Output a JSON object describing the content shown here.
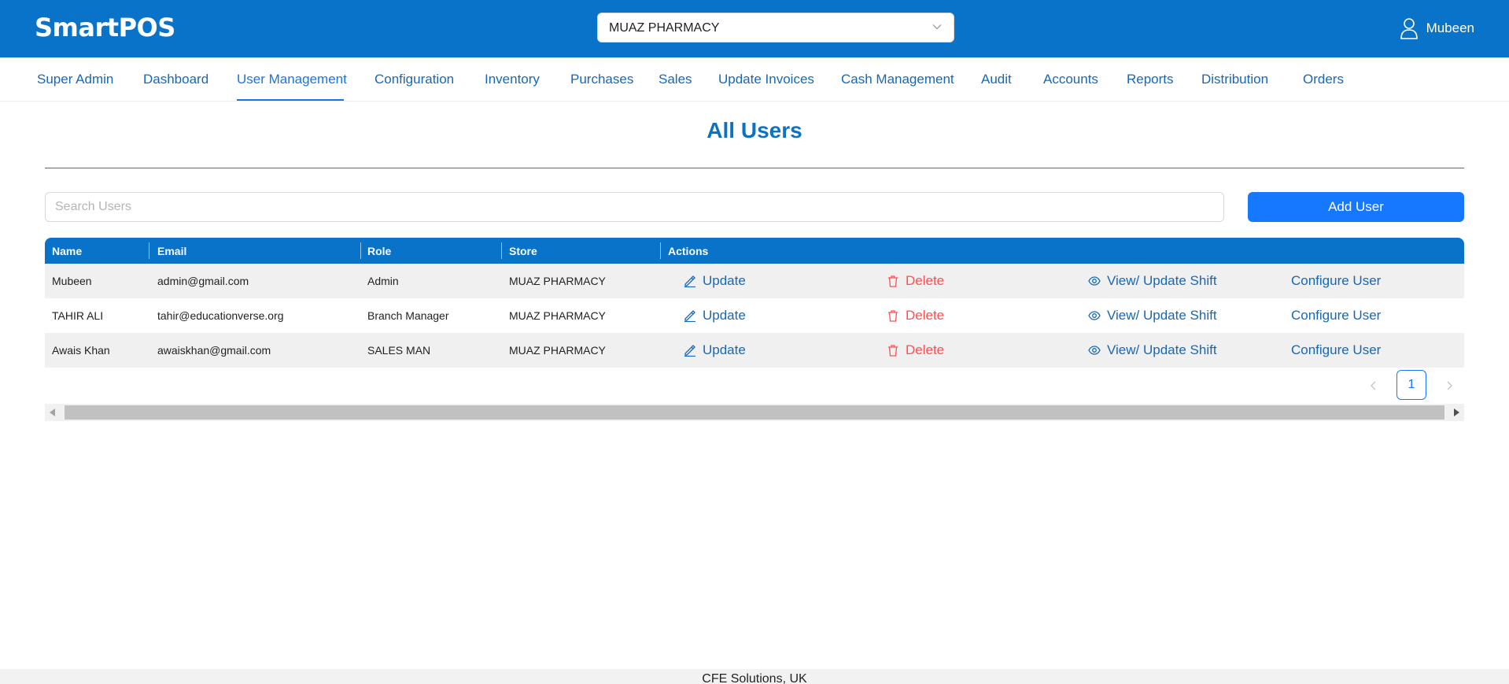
{
  "header": {
    "brand": "SmartPOS",
    "store_select": {
      "value": "MUAZ PHARMACY"
    },
    "user": {
      "name": "Mubeen"
    }
  },
  "nav": {
    "items": [
      {
        "label": "Super Admin"
      },
      {
        "label": "Dashboard"
      },
      {
        "label": "User Management",
        "active": true
      },
      {
        "label": "Configuration"
      },
      {
        "label": "Inventory"
      },
      {
        "label": "Purchases"
      },
      {
        "label": "Sales"
      },
      {
        "label": "Update Invoices"
      },
      {
        "label": "Cash Management"
      },
      {
        "label": "Audit"
      },
      {
        "label": "Accounts"
      },
      {
        "label": "Reports"
      },
      {
        "label": "Distribution"
      },
      {
        "label": "Orders"
      }
    ]
  },
  "page": {
    "title": "All Users",
    "search": {
      "placeholder": "Search Users",
      "value": ""
    },
    "add_button": "Add User"
  },
  "table": {
    "columns": [
      "Name",
      "Email",
      "Role",
      "Store",
      "Actions"
    ],
    "actions": {
      "update": "Update",
      "delete": "Delete",
      "shift": "View/ Update Shift",
      "configure": "Configure User"
    },
    "rows": [
      {
        "name": "Mubeen",
        "email": "admin@gmail.com",
        "role": "Admin",
        "store": "MUAZ PHARMACY"
      },
      {
        "name": "TAHIR ALI",
        "email": "tahir@educationverse.org",
        "role": "Branch Manager",
        "store": "MUAZ PHARMACY"
      },
      {
        "name": "Awais Khan",
        "email": "awaiskhan@gmail.com",
        "role": "SALES MAN",
        "store": "MUAZ PHARMACY"
      }
    ]
  },
  "pagination": {
    "current_page": "1"
  },
  "footer": {
    "text": "CFE Solutions, UK"
  },
  "colors": {
    "header_bg": "#0873c9",
    "primary": "#1677ff",
    "link": "#1668b6",
    "danger": "#ff4d4f"
  }
}
